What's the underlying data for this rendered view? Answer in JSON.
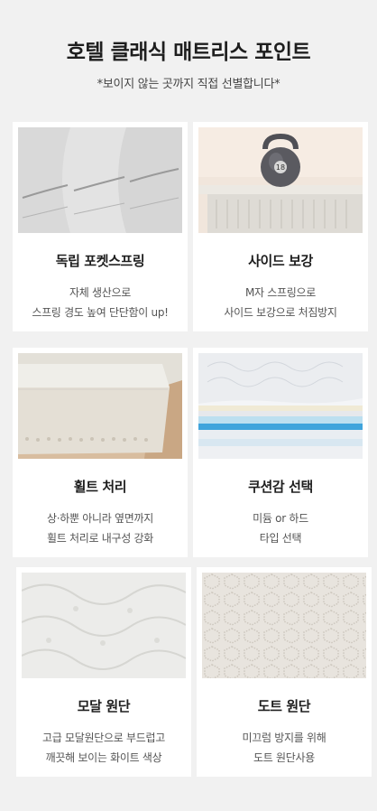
{
  "header": {
    "title": "호텔 클래식 매트리스 포인트",
    "subtitle": "*보이지 않는 곳까지 직접 선별합니다*"
  },
  "features": [
    {
      "title": "독립 포켓스프링",
      "desc": [
        "자체 생산으로",
        "스프링 경도 높여 단단함이 up!"
      ],
      "image": "pocket-spring-photo"
    },
    {
      "title": "사이드 보강",
      "desc": [
        "M자 스프링으로",
        "사이드 보강으로 처짐방지"
      ],
      "image": "side-reinforcement-photo"
    },
    {
      "title": "휠트 처리",
      "desc": [
        "상·하뿐 아니라 옆면까지",
        "휠트 처리로 내구성 강화"
      ],
      "image": "felt-treatment-photo"
    },
    {
      "title": "쿠션감 선택",
      "desc": [
        "미듐 or 하드",
        "타입 선택"
      ],
      "image": "cushion-layers-photo"
    },
    {
      "title": "모달 원단",
      "desc": [
        "고급 모달원단으로 부드럽고",
        "깨끗해 보이는 화이트 색상"
      ],
      "image": "modal-fabric-photo"
    },
    {
      "title": "도트 원단",
      "desc": [
        "미끄럼 방지를 위해",
        "도트 원단사용"
      ],
      "image": "dot-fabric-photo"
    }
  ],
  "kettlebell_label": "18"
}
